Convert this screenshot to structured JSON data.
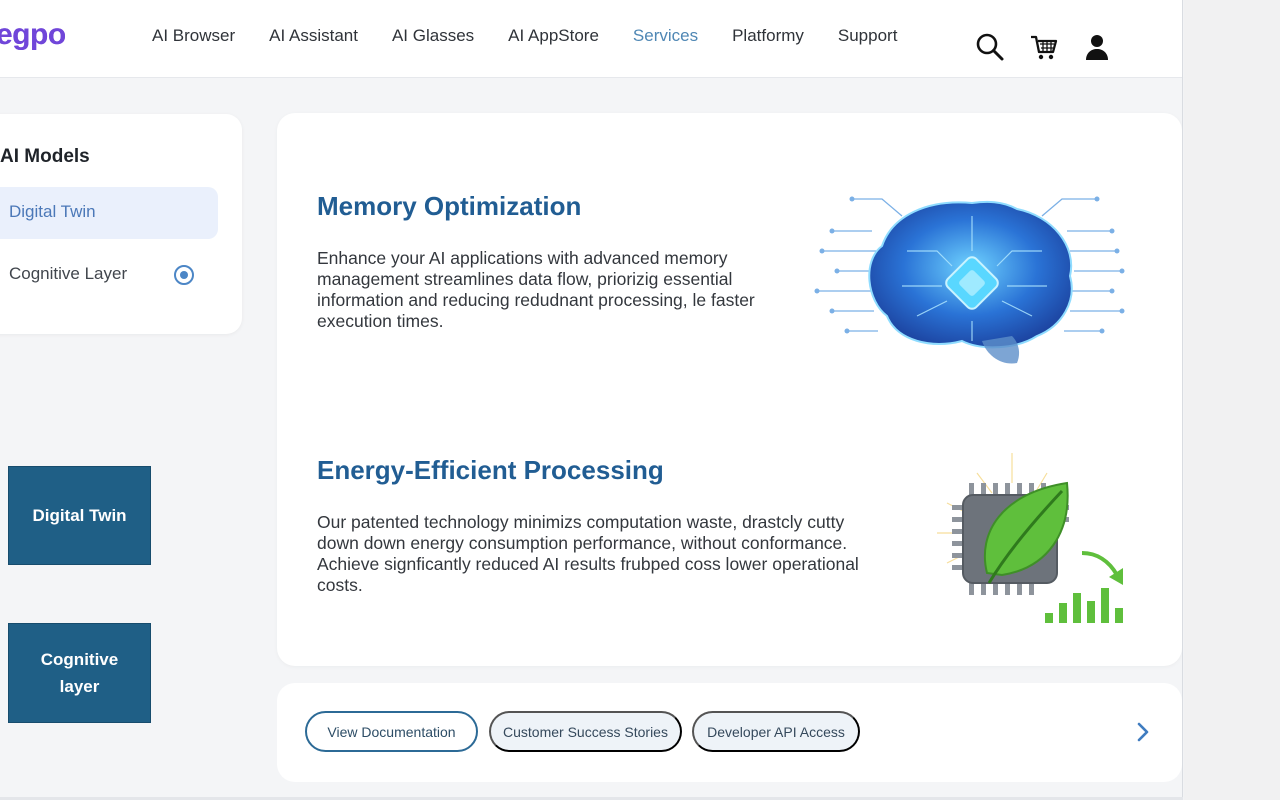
{
  "header": {
    "logo": "egpo",
    "nav": [
      {
        "label": "AI Browser"
      },
      {
        "label": "AI Assistant"
      },
      {
        "label": "AI Glasses"
      },
      {
        "label": "AI AppStore"
      },
      {
        "label": "Services",
        "active": true
      },
      {
        "label": "Platformy"
      },
      {
        "label": "Support"
      }
    ],
    "icons": [
      "search-icon",
      "cart-icon",
      "user-icon"
    ],
    "active_color": "#4f87b4"
  },
  "sidebar": {
    "title": "AI Models",
    "items": [
      {
        "label": "Digital Twin",
        "selected": true
      },
      {
        "label": "Cognitive Layer",
        "selected": false
      }
    ]
  },
  "tiles": [
    {
      "label": "Digital Twin"
    },
    {
      "label": "Cognitive layer"
    }
  ],
  "features": [
    {
      "title": "Memory Optimization",
      "description": "Enhance your AI applications with advanced memory management streamlines data flow, priorizig essential information and reducing redudnant processing, le faster execution times.",
      "icon": "brain-circuit-icon"
    },
    {
      "title": "Energy-Efficient Processing",
      "description": "Our patented technology minimizs computation waste, drastcly cutty down down energy consumption performance, without conformance. Achieve signficantly reduced AI results frubped coss lower operational costs.",
      "icon": "leaf-chip-icon"
    }
  ],
  "actions": [
    {
      "label": "View Documentation"
    },
    {
      "label": "Customer Success Stories"
    },
    {
      "label": "Developer API Access"
    }
  ],
  "colors": {
    "brand": "#7046d9",
    "title_blue": "#215d93",
    "tile_blue": "#1f5f86"
  }
}
